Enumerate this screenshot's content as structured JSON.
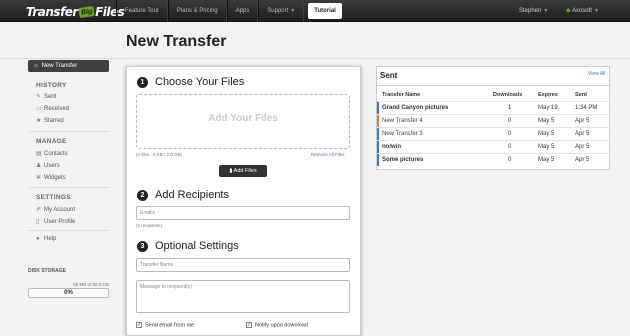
{
  "logo": {
    "part1": "Transfer",
    "part2": "Big",
    "part3": "Files"
  },
  "nav": {
    "feature_tour": "Feature Tour",
    "plans": "Plans & Pricing",
    "apps": "Apps",
    "support": "Support",
    "tutorial": "Tutorial"
  },
  "user": {
    "name": "Stephen",
    "account": "Axosoft"
  },
  "page_title": "New Transfer",
  "sidebar": {
    "new_transfer": "New Transfer",
    "history": "HISTORY",
    "sent": "Sent",
    "received": "Received",
    "starred": "Starred",
    "manage": "MANAGE",
    "contacts": "Contacts",
    "users": "Users",
    "widgets": "Widgets",
    "settings": "SETTINGS",
    "my_account": "My Account",
    "user_profile": "User Profile",
    "help": "Help",
    "disk_storage": "DISK STORAGE",
    "disk_usage": "50 MB of 50.0 GB",
    "disk_percent": "0%"
  },
  "form": {
    "step1_num": "1",
    "step1": "Choose Your Files",
    "drop_label": "Add Your Files",
    "files_info": "(0 files : 0 KB / 2.0 GB)",
    "remove_all": "Remove All Files",
    "add_files": "Add Files",
    "step2_num": "2",
    "step2": "Add Recipients",
    "emails_placeholder": "Emails",
    "recipients_count": "(0 recipients)",
    "step3_num": "3",
    "step3": "Optional Settings",
    "transfer_name_placeholder": "Transfer Name",
    "message_placeholder": "Message to recipient(s)",
    "send_email": "Send email from me",
    "notify": "Notify upon download"
  },
  "sent": {
    "title": "Sent",
    "view_all": "View All",
    "headers": {
      "name": "Transfer Name",
      "downloads": "Downloads",
      "expires": "Expires",
      "sent": "Sent"
    },
    "rows": [
      {
        "name": "Grand Canyon pictures",
        "downloads": "1",
        "expires": "May 19",
        "sent": "1:34 PM",
        "color": "#3b76c4"
      },
      {
        "name": "New Transfer 4",
        "downloads": "0",
        "expires": "May 5",
        "sent": "Apr 5",
        "color": "#d9822b"
      },
      {
        "name": "New Transfer 3",
        "downloads": "0",
        "expires": "May 5",
        "sent": "Apr 5",
        "color": "#3b76c4"
      },
      {
        "name": "no/win",
        "downloads": "0",
        "expires": "May 5",
        "sent": "Apr 5",
        "color": "#3b76c4"
      },
      {
        "name": "Some pictures",
        "downloads": "0",
        "expires": "May 5",
        "sent": "Apr 5",
        "color": "#3b76c4"
      }
    ]
  }
}
